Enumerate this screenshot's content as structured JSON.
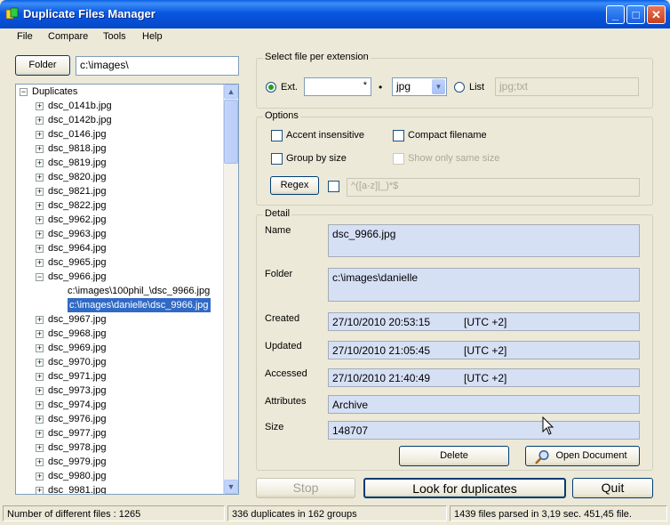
{
  "window": {
    "title": "Duplicate Files Manager",
    "minimize": "_",
    "maximize": "□",
    "close": "✕"
  },
  "menu": [
    "File",
    "Compare",
    "Tools",
    "Help"
  ],
  "folder": {
    "button": "Folder",
    "path": "c:\\images\\"
  },
  "tree": {
    "root": "Duplicates",
    "items": [
      "dsc_0141b.jpg",
      "dsc_0142b.jpg",
      "dsc_0146.jpg",
      "dsc_9818.jpg",
      "dsc_9819.jpg",
      "dsc_9820.jpg",
      "dsc_9821.jpg",
      "dsc_9822.jpg",
      "dsc_9962.jpg",
      "dsc_9963.jpg",
      "dsc_9964.jpg",
      "dsc_9965.jpg",
      "dsc_9966.jpg"
    ],
    "expanded_children": [
      "c:\\images\\100phil_\\dsc_9966.jpg",
      "c:\\images\\danielle\\dsc_9966.jpg"
    ],
    "items_after": [
      "dsc_9967.jpg",
      "dsc_9968.jpg",
      "dsc_9969.jpg",
      "dsc_9970.jpg",
      "dsc_9971.jpg",
      "dsc_9973.jpg",
      "dsc_9974.jpg",
      "dsc_9976.jpg",
      "dsc_9977.jpg",
      "dsc_9978.jpg",
      "dsc_9979.jpg",
      "dsc_9980.jpg",
      "dsc_9981.jpg"
    ]
  },
  "extension": {
    "title": "Select file per extension",
    "ext_label": "Ext.",
    "ext_value": "*",
    "dot": "•",
    "combo_value": "jpg",
    "list_label": "List",
    "list_value": "jpg;txt"
  },
  "options": {
    "title": "Options",
    "accent": "Accent  insensitive",
    "compact": "Compact filename",
    "group_size": "Group by size",
    "show_same": "Show only same size",
    "regex_button": "Regex",
    "regex_value": "^([a-z]|_)*$"
  },
  "detail": {
    "title": "Detail",
    "name_label": "Name",
    "name": "dsc_9966.jpg",
    "folder_label": "Folder",
    "folder": "c:\\images\\danielle",
    "created_label": "Created",
    "created": "27/10/2010 20:53:15",
    "created_tz": "[UTC +2]",
    "updated_label": "Updated",
    "updated": "27/10/2010 21:05:45",
    "updated_tz": "[UTC +2]",
    "accessed_label": "Accessed",
    "accessed": "27/10/2010 21:40:49",
    "accessed_tz": "[UTC +2]",
    "attributes_label": "Attributes",
    "attributes": "Archive",
    "size_label": "Size",
    "size": "148707",
    "delete_button": "Delete",
    "open_button": "Open Document"
  },
  "actions": {
    "stop": "Stop",
    "look": "Look for duplicates",
    "quit": "Quit"
  },
  "status": {
    "different": "Number of different files : 1265",
    "duplicates": "336 duplicates in 162 groups",
    "parsed": "1439 files parsed in 3,19 sec. 451,45 file."
  }
}
